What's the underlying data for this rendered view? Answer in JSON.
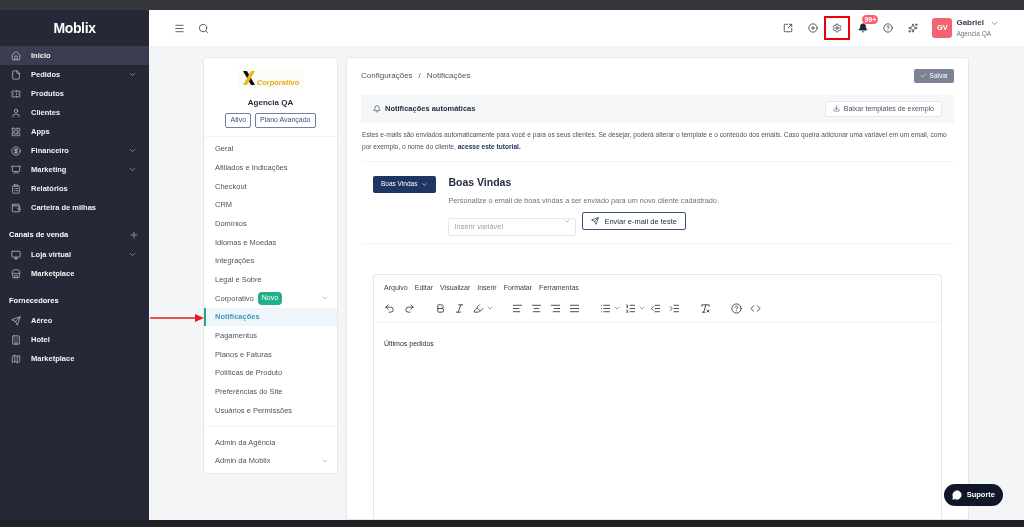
{
  "sidebar": {
    "logo": "Moblix",
    "items": [
      {
        "kind": "item",
        "label": "Inicio",
        "selected": true,
        "expandable": false
      },
      {
        "kind": "item",
        "label": "Pedidos",
        "selected": false,
        "expandable": true
      },
      {
        "kind": "item",
        "label": "Produtos",
        "selected": false,
        "expandable": false
      },
      {
        "kind": "item",
        "label": "Clientes",
        "selected": false,
        "expandable": false
      },
      {
        "kind": "item",
        "label": "Apps",
        "selected": false,
        "expandable": false
      },
      {
        "kind": "item",
        "label": "Financeiro",
        "selected": false,
        "expandable": true
      },
      {
        "kind": "item",
        "label": "Marketing",
        "selected": false,
        "expandable": true
      },
      {
        "kind": "item",
        "label": "Relatórios",
        "selected": false,
        "expandable": false
      },
      {
        "kind": "item",
        "label": "Carteira de milhas",
        "selected": false,
        "expandable": false
      },
      {
        "kind": "section",
        "label": "Canais de venda",
        "addable": true
      },
      {
        "kind": "item",
        "label": "Loja virtual",
        "selected": false,
        "expandable": true
      },
      {
        "kind": "item",
        "label": "Marketplace",
        "selected": false,
        "expandable": false
      },
      {
        "kind": "section",
        "label": "Fornecedores",
        "addable": false
      },
      {
        "kind": "item",
        "label": "Aéreo",
        "selected": false,
        "expandable": false
      },
      {
        "kind": "item",
        "label": "Hotel",
        "selected": false,
        "expandable": false
      },
      {
        "kind": "item",
        "label": "Marketplace",
        "selected": false,
        "expandable": false
      }
    ]
  },
  "header": {
    "notification_count": "99+",
    "user": {
      "initials": "GV",
      "name": "Gabriel",
      "company": "Agencia QA"
    }
  },
  "settings_menu": {
    "logo_text": "Corporativo",
    "company": "Agencia QA",
    "badges": [
      "Ativo",
      "Plano Avançado"
    ],
    "items": [
      {
        "label": "Geral",
        "selected": false,
        "expandable": false
      },
      {
        "label": "Afiliados e Indicações",
        "selected": false,
        "expandable": false
      },
      {
        "label": "Checkout",
        "selected": false,
        "expandable": false
      },
      {
        "label": "CRM",
        "selected": false,
        "expandable": false
      },
      {
        "label": "Domínios",
        "selected": false,
        "expandable": false
      },
      {
        "label": "Idiomas e Moedas",
        "selected": false,
        "expandable": false
      },
      {
        "label": "Integrações",
        "selected": false,
        "expandable": false
      },
      {
        "label": "Legal e Sobre",
        "selected": false,
        "expandable": false
      },
      {
        "label": "Corporativo",
        "badge": "Novo",
        "selected": false,
        "expandable": true
      },
      {
        "label": "Notificações",
        "selected": true,
        "expandable": false
      },
      {
        "label": "Pagamentos",
        "selected": false,
        "expandable": false
      },
      {
        "label": "Planos e Faturas",
        "selected": false,
        "expandable": false
      },
      {
        "label": "Políticas de Produto",
        "selected": false,
        "expandable": false
      },
      {
        "label": "Preferências do Site",
        "selected": false,
        "expandable": false
      },
      {
        "label": "Usuários e Permissões",
        "selected": false,
        "expandable": false
      }
    ],
    "admin_items": [
      {
        "label": "Admin da Agência",
        "selected": false,
        "expandable": false
      },
      {
        "label": "Admin da Moblix",
        "selected": false,
        "expandable": true
      }
    ]
  },
  "main": {
    "breadcrumb": {
      "items": [
        "Configurações",
        "Notificações"
      ],
      "separator": "/"
    },
    "save_button": "Salvar",
    "section_title": "Notificações automáticas",
    "download_button": "Baixar templates de exemplo",
    "description": "Estes e-mails são enviados automaticamente para você e para os seus clientes. Se desejar, poderá alterar o template e o conteúdo dos emails. Caso queira adicionar uma variável em um email, como por exemplo, o nome do cliente,",
    "description_link": "acesse este tutorial.",
    "template_dropdown": "Boas Vindas",
    "template_title": "Boas Vindas",
    "template_subtitle": "Personalize o email de boas vindas a ser enviado para um novo cliente cadastrado.",
    "variable_select": {
      "placeholder": "Inserir variável"
    },
    "test_button": "Enviar e-mail de teste",
    "editor": {
      "menus": [
        "Arquivo",
        "Editar",
        "Visualizar",
        "Inserir",
        "Formatar",
        "Ferramentas"
      ],
      "content": "Últimos pedidos"
    }
  },
  "support_button": "Suporte"
}
